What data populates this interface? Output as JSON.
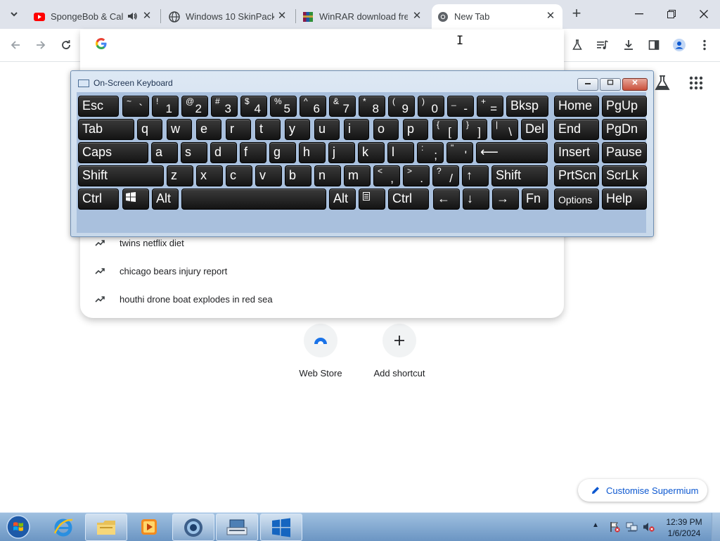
{
  "tabs": [
    {
      "title": "SpongeBob & Cal",
      "favicon": "youtube-icon",
      "audio": true
    },
    {
      "title": "Windows 10 SkinPack",
      "favicon": "globe-icon"
    },
    {
      "title": "WinRAR download fre",
      "favicon": "winrar-icon"
    },
    {
      "title": "New Tab",
      "favicon": "chrome-icon",
      "active": true
    }
  ],
  "omnibox": {
    "suggestions": [
      {
        "text": "twins netflix diet",
        "icon": "trending-icon"
      },
      {
        "text": "chicago bears injury report",
        "icon": "trending-icon"
      },
      {
        "text": "houthi drone boat explodes in red sea",
        "icon": "trending-icon"
      }
    ]
  },
  "osk": {
    "title": "On-Screen Keyboard",
    "rows": [
      [
        {
          "m": "Esc"
        },
        {
          "s": "~",
          "m": "`"
        },
        {
          "s": "!",
          "m": "1"
        },
        {
          "s": "@",
          "m": "2"
        },
        {
          "s": "#",
          "m": "3"
        },
        {
          "s": "$",
          "m": "4"
        },
        {
          "s": "%",
          "m": "5"
        },
        {
          "s": "^",
          "m": "6"
        },
        {
          "s": "&",
          "m": "7"
        },
        {
          "s": "*",
          "m": "8"
        },
        {
          "s": "(",
          "m": "9"
        },
        {
          "s": ")",
          "m": "0"
        },
        {
          "s": "_",
          "m": "-"
        },
        {
          "s": "+",
          "m": "="
        },
        {
          "m": "Bksp"
        },
        {
          "m": "Home"
        },
        {
          "m": "PgUp"
        }
      ],
      [
        {
          "m": "Tab"
        },
        {
          "m": "q"
        },
        {
          "m": "w"
        },
        {
          "m": "e"
        },
        {
          "m": "r"
        },
        {
          "m": "t"
        },
        {
          "m": "y"
        },
        {
          "m": "u"
        },
        {
          "m": "i"
        },
        {
          "m": "o"
        },
        {
          "m": "p"
        },
        {
          "s": "{",
          "m": "["
        },
        {
          "s": "}",
          "m": "]"
        },
        {
          "s": "|",
          "m": "\\"
        },
        {
          "m": "Del"
        },
        {
          "m": "End"
        },
        {
          "m": "PgDn"
        }
      ],
      [
        {
          "m": "Caps"
        },
        {
          "m": "a"
        },
        {
          "m": "s"
        },
        {
          "m": "d"
        },
        {
          "m": "f"
        },
        {
          "m": "g"
        },
        {
          "m": "h"
        },
        {
          "m": "j"
        },
        {
          "m": "k"
        },
        {
          "m": "l"
        },
        {
          "s": ":",
          "m": ";"
        },
        {
          "s": "\"",
          "m": "'"
        },
        {
          "m": "⟵"
        },
        {
          "m": "Insert"
        },
        {
          "m": "Pause"
        }
      ],
      [
        {
          "m": "Shift"
        },
        {
          "m": "z"
        },
        {
          "m": "x"
        },
        {
          "m": "c"
        },
        {
          "m": "v"
        },
        {
          "m": "b"
        },
        {
          "m": "n"
        },
        {
          "m": "m"
        },
        {
          "s": "<",
          "m": ","
        },
        {
          "s": ">",
          "m": "."
        },
        {
          "s": "?",
          "m": "/"
        },
        {
          "m": "↑"
        },
        {
          "m": "Shift"
        },
        {
          "m": "PrtScn"
        },
        {
          "m": "ScrLk"
        }
      ],
      [
        {
          "m": "Ctrl"
        },
        {
          "m": "",
          "icon": "windows-logo-icon"
        },
        {
          "m": "Alt"
        },
        {
          "m": ""
        },
        {
          "m": "Alt"
        },
        {
          "m": "",
          "icon": "menu-key-icon"
        },
        {
          "m": "Ctrl"
        },
        {
          "m": "←"
        },
        {
          "m": "↓"
        },
        {
          "m": "→"
        },
        {
          "m": "Fn"
        },
        {
          "m": "Options"
        },
        {
          "m": "Help"
        }
      ]
    ]
  },
  "shortcuts": [
    {
      "label": "Web Store",
      "icon": "web-store-icon"
    },
    {
      "label": "Add shortcut",
      "icon": "plus-icon"
    }
  ],
  "customise": {
    "label": "Customise Supermium"
  },
  "taskbar": {
    "time": "12:39 PM",
    "date": "1/6/2024",
    "apps": [
      "internet-explorer-icon",
      "file-explorer-icon",
      "media-player-icon",
      "browser-icon",
      "on-screen-keyboard-icon",
      "windows-app-icon"
    ]
  }
}
